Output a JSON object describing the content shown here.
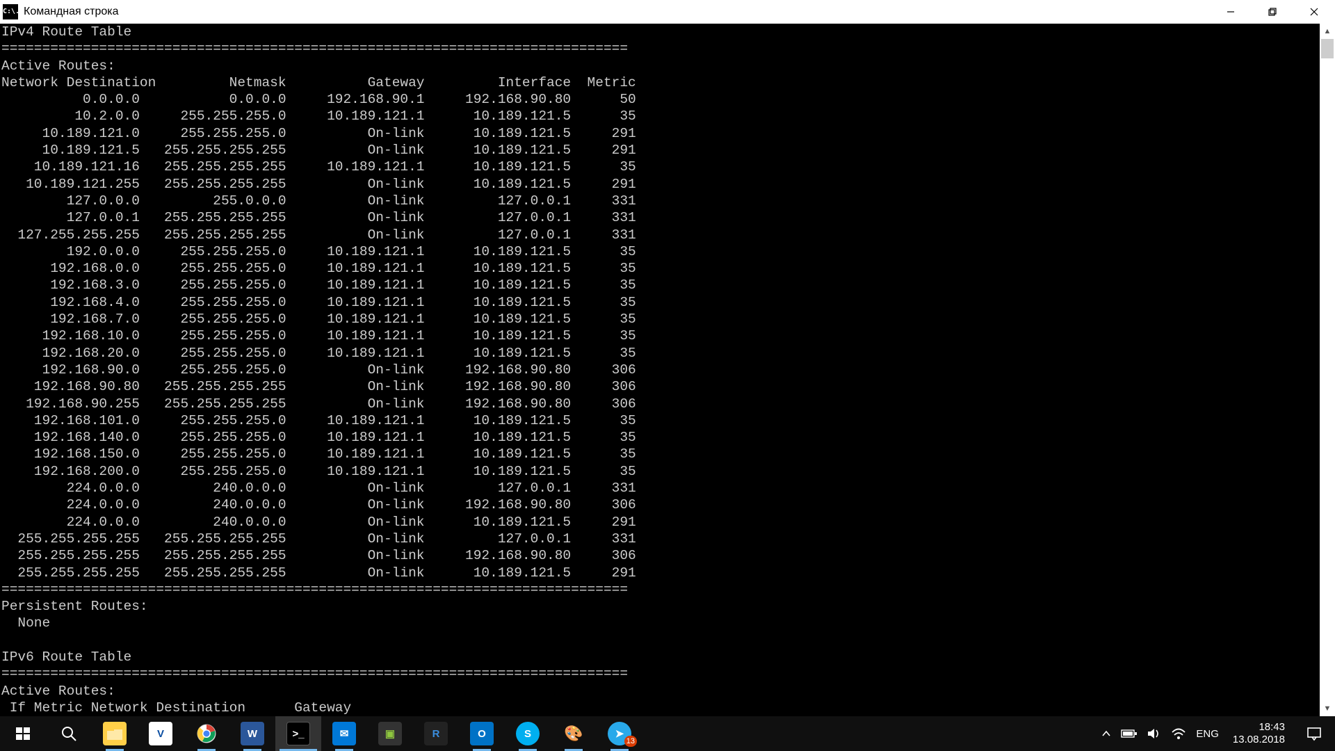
{
  "window": {
    "title": "Командная строка",
    "icon_text": "C:\\."
  },
  "terminal": {
    "title_v4": "IPv4 Route Table",
    "active_routes": "Active Routes:",
    "col_dest": "Network Destination",
    "col_mask": "Netmask",
    "col_gw": "Gateway",
    "col_if": "Interface",
    "col_metric": "Metric",
    "rows": [
      {
        "d": "0.0.0.0",
        "m": "0.0.0.0",
        "g": "192.168.90.1",
        "i": "192.168.90.80",
        "met": "50"
      },
      {
        "d": "10.2.0.0",
        "m": "255.255.255.0",
        "g": "10.189.121.1",
        "i": "10.189.121.5",
        "met": "35"
      },
      {
        "d": "10.189.121.0",
        "m": "255.255.255.0",
        "g": "On-link",
        "i": "10.189.121.5",
        "met": "291"
      },
      {
        "d": "10.189.121.5",
        "m": "255.255.255.255",
        "g": "On-link",
        "i": "10.189.121.5",
        "met": "291"
      },
      {
        "d": "10.189.121.16",
        "m": "255.255.255.255",
        "g": "10.189.121.1",
        "i": "10.189.121.5",
        "met": "35"
      },
      {
        "d": "10.189.121.255",
        "m": "255.255.255.255",
        "g": "On-link",
        "i": "10.189.121.5",
        "met": "291"
      },
      {
        "d": "127.0.0.0",
        "m": "255.0.0.0",
        "g": "On-link",
        "i": "127.0.0.1",
        "met": "331"
      },
      {
        "d": "127.0.0.1",
        "m": "255.255.255.255",
        "g": "On-link",
        "i": "127.0.0.1",
        "met": "331"
      },
      {
        "d": "127.255.255.255",
        "m": "255.255.255.255",
        "g": "On-link",
        "i": "127.0.0.1",
        "met": "331"
      },
      {
        "d": "192.0.0.0",
        "m": "255.255.255.0",
        "g": "10.189.121.1",
        "i": "10.189.121.5",
        "met": "35"
      },
      {
        "d": "192.168.0.0",
        "m": "255.255.255.0",
        "g": "10.189.121.1",
        "i": "10.189.121.5",
        "met": "35"
      },
      {
        "d": "192.168.3.0",
        "m": "255.255.255.0",
        "g": "10.189.121.1",
        "i": "10.189.121.5",
        "met": "35"
      },
      {
        "d": "192.168.4.0",
        "m": "255.255.255.0",
        "g": "10.189.121.1",
        "i": "10.189.121.5",
        "met": "35"
      },
      {
        "d": "192.168.7.0",
        "m": "255.255.255.0",
        "g": "10.189.121.1",
        "i": "10.189.121.5",
        "met": "35"
      },
      {
        "d": "192.168.10.0",
        "m": "255.255.255.0",
        "g": "10.189.121.1",
        "i": "10.189.121.5",
        "met": "35"
      },
      {
        "d": "192.168.20.0",
        "m": "255.255.255.0",
        "g": "10.189.121.1",
        "i": "10.189.121.5",
        "met": "35"
      },
      {
        "d": "192.168.90.0",
        "m": "255.255.255.0",
        "g": "On-link",
        "i": "192.168.90.80",
        "met": "306"
      },
      {
        "d": "192.168.90.80",
        "m": "255.255.255.255",
        "g": "On-link",
        "i": "192.168.90.80",
        "met": "306"
      },
      {
        "d": "192.168.90.255",
        "m": "255.255.255.255",
        "g": "On-link",
        "i": "192.168.90.80",
        "met": "306"
      },
      {
        "d": "192.168.101.0",
        "m": "255.255.255.0",
        "g": "10.189.121.1",
        "i": "10.189.121.5",
        "met": "35"
      },
      {
        "d": "192.168.140.0",
        "m": "255.255.255.0",
        "g": "10.189.121.1",
        "i": "10.189.121.5",
        "met": "35"
      },
      {
        "d": "192.168.150.0",
        "m": "255.255.255.0",
        "g": "10.189.121.1",
        "i": "10.189.121.5",
        "met": "35"
      },
      {
        "d": "192.168.200.0",
        "m": "255.255.255.0",
        "g": "10.189.121.1",
        "i": "10.189.121.5",
        "met": "35"
      },
      {
        "d": "224.0.0.0",
        "m": "240.0.0.0",
        "g": "On-link",
        "i": "127.0.0.1",
        "met": "331"
      },
      {
        "d": "224.0.0.0",
        "m": "240.0.0.0",
        "g": "On-link",
        "i": "192.168.90.80",
        "met": "306"
      },
      {
        "d": "224.0.0.0",
        "m": "240.0.0.0",
        "g": "On-link",
        "i": "10.189.121.5",
        "met": "291"
      },
      {
        "d": "255.255.255.255",
        "m": "255.255.255.255",
        "g": "On-link",
        "i": "127.0.0.1",
        "met": "331"
      },
      {
        "d": "255.255.255.255",
        "m": "255.255.255.255",
        "g": "On-link",
        "i": "192.168.90.80",
        "met": "306"
      },
      {
        "d": "255.255.255.255",
        "m": "255.255.255.255",
        "g": "On-link",
        "i": "10.189.121.5",
        "met": "291"
      }
    ],
    "persistent": "Persistent Routes:",
    "none": "  None",
    "title_v6": "IPv6 Route Table",
    "v6_header": " If Metric Network Destination      Gateway"
  },
  "taskbar": {
    "lang": "ENG",
    "time": "18:43",
    "date": "13.08.2018",
    "telegram_badge": "13"
  }
}
